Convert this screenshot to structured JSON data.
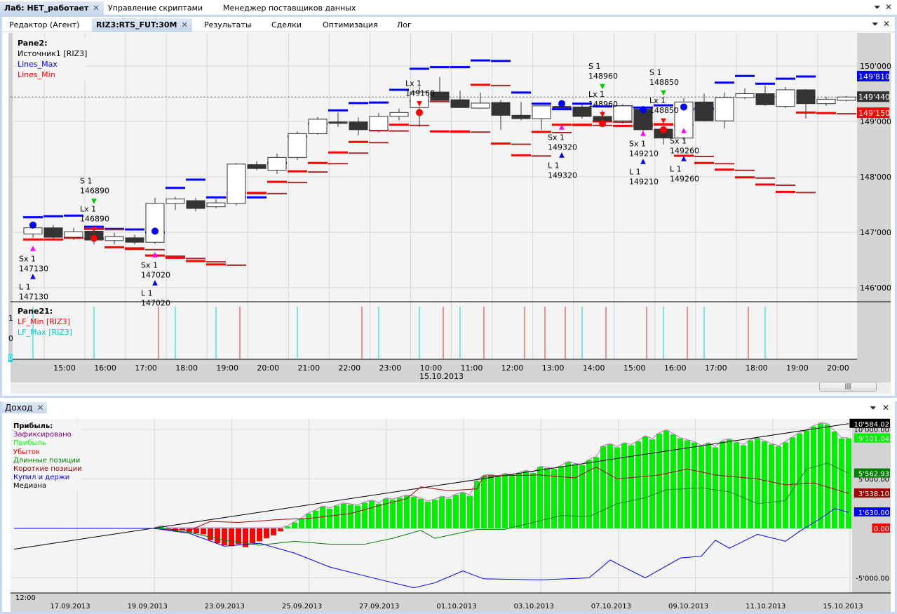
{
  "top_tabs": [
    {
      "label": "Лаб: НЕТ_работает",
      "active": true
    },
    {
      "label": "Управление скриптами"
    },
    {
      "label": "Менеджер поставщиков данных"
    }
  ],
  "sub_tabs": [
    {
      "label": "Редактор (Агент)"
    },
    {
      "label": "RIZ3:RTS_FUT:30M",
      "active": true
    },
    {
      "label": "Результаты"
    },
    {
      "label": "Сделки"
    },
    {
      "label": "Оптимизация"
    },
    {
      "label": "Лог"
    }
  ],
  "colors": {
    "max": "#0000ff",
    "min": "#ff0000",
    "min_dark": "#a52a2a",
    "cyan": "#00d8d8",
    "profit": "#00ee00",
    "loss": "#ff0000"
  },
  "price_pane": {
    "title": "Pane2:",
    "source": "Источник1 [RIZ3]",
    "legend_max": "Lines_Max",
    "legend_min": "Lines_Min",
    "y_ticks": [
      "150'000",
      "149'000",
      "148'000",
      "147'000",
      "146'000"
    ],
    "markers": {
      "max": "149'810",
      "last": "149'440",
      "min": "149'150"
    }
  },
  "indicator_pane": {
    "title": "Pane21:",
    "legend_min": "LF_Min [RIZ3]",
    "legend_max": "LF_Max [RIZ3]",
    "y_ticks": [
      "1",
      "0",
      "0"
    ],
    "min_bars": [
      6,
      10,
      16,
      20,
      22,
      24,
      25,
      26,
      28,
      30,
      32,
      35
    ],
    "max_bars": [
      0,
      3,
      7,
      9,
      13,
      17,
      19,
      21,
      27,
      31,
      33,
      36
    ]
  },
  "time_axis": {
    "labels": [
      "15:00",
      "16:00",
      "17:00",
      "18:00",
      "19:00",
      "20:00",
      "21:00",
      "22:00",
      "23:00",
      "10:00",
      "11:00",
      "12:00",
      "13:00",
      "14:00",
      "15:00",
      "16:00",
      "17:00",
      "18:00",
      "19:00",
      "20:00"
    ],
    "date": "15.10.2013"
  },
  "candles": [
    [
      146970,
      147130,
      146900,
      147080
    ],
    [
      147080,
      147130,
      146880,
      146910
    ],
    [
      146910,
      147080,
      146860,
      147010
    ],
    [
      147020,
      147050,
      146780,
      146860
    ],
    [
      146850,
      146990,
      146780,
      146920
    ],
    [
      146900,
      146960,
      146780,
      146820
    ],
    [
      146820,
      147620,
      146790,
      147520
    ],
    [
      147520,
      147640,
      147400,
      147600
    ],
    [
      147570,
      147620,
      147380,
      147430
    ],
    [
      147460,
      147600,
      147430,
      147530
    ],
    [
      147520,
      148250,
      147480,
      148230
    ],
    [
      148220,
      148280,
      148120,
      148150
    ],
    [
      148120,
      148420,
      148050,
      148350
    ],
    [
      148350,
      148820,
      148300,
      148780
    ],
    [
      148780,
      149080,
      148760,
      149040
    ],
    [
      148990,
      149160,
      148900,
      148980
    ],
    [
      148990,
      149070,
      148750,
      148850
    ],
    [
      148840,
      149150,
      148800,
      149090
    ],
    [
      149090,
      149230,
      149020,
      149160
    ],
    [
      149250,
      149620,
      148900,
      149530
    ],
    [
      149530,
      149800,
      149480,
      149380
    ],
    [
      149390,
      149550,
      149300,
      149250
    ],
    [
      149240,
      149520,
      149230,
      149330
    ],
    [
      149340,
      149380,
      148850,
      149110
    ],
    [
      149110,
      149350,
      149020,
      149050
    ],
    [
      149050,
      149280,
      148850,
      149280
    ],
    [
      149270,
      149310,
      149210,
      149250
    ],
    [
      149260,
      149300,
      149050,
      149090
    ],
    [
      149090,
      149200,
      149000,
      149010
    ],
    [
      149010,
      149310,
      148960,
      149280
    ],
    [
      149220,
      149280,
      148780,
      148850
    ],
    [
      148860,
      148900,
      148580,
      148700
    ],
    [
      148700,
      149420,
      148650,
      149350
    ],
    [
      149350,
      149500,
      149000,
      149010
    ],
    [
      149010,
      149520,
      148870,
      149430
    ],
    [
      149430,
      149600,
      149400,
      149500
    ],
    [
      149500,
      149650,
      149280,
      149300
    ],
    [
      149270,
      149620,
      149240,
      149570
    ],
    [
      149570,
      149580,
      149050,
      149320
    ],
    [
      149320,
      149450,
      149280,
      149400
    ],
    [
      149380,
      149460,
      149360,
      149440
    ]
  ],
  "lines_max": [
    147270,
    147290,
    147300,
    147100,
    147060,
    147050,
    147000,
    147800,
    147950,
    147630,
    147630,
    147630,
    148250,
    148730,
    148960,
    149200,
    149330,
    149340,
    149570,
    149950,
    149980,
    149980,
    150100,
    150090,
    149520,
    149320,
    149220,
    149320,
    149270,
    149270,
    149250,
    149290,
    149220,
    149230,
    149700,
    149820,
    149680,
    149770,
    149810
  ],
  "lines_min": [
    146870,
    146870,
    146900,
    147060,
    146730,
    146700,
    146580,
    146540,
    146480,
    146420,
    147710,
    147710,
    147910,
    148100,
    148250,
    148440,
    148630,
    148840,
    148940,
    149370,
    148820,
    148820,
    149660,
    148600,
    148390,
    148810,
    148940,
    148940,
    149000,
    148920,
    148950,
    148950,
    148380,
    148250,
    148130,
    147990,
    147860,
    147730,
    149160,
    149150
  ],
  "signals": [
    {
      "bar": 0,
      "side": "below",
      "entries": [
        {
          "name": "Sx 1",
          "price": "147130",
          "icon": "short-exit"
        },
        {
          "name": "L 1",
          "price": "147130",
          "icon": "buy"
        }
      ]
    },
    {
      "bar": 3,
      "side": "above",
      "entries": [
        {
          "name": "S 1",
          "price": "146890",
          "icon": "sell"
        },
        {
          "name": "Lx 1",
          "price": "146890",
          "icon": "long-exit"
        }
      ]
    },
    {
      "bar": 6,
      "side": "below",
      "entries": [
        {
          "name": "Sx 1",
          "price": "147020",
          "icon": "short-exit"
        },
        {
          "name": "L 1",
          "price": "147020",
          "icon": "buy"
        }
      ]
    },
    {
      "bar": 19,
      "side": "above",
      "entries": [
        {
          "name": "Lx 1",
          "price": "149160",
          "icon": "long-exit"
        }
      ]
    },
    {
      "bar": 26,
      "side": "below",
      "entries": [
        {
          "name": "Sx 1",
          "price": "149320",
          "icon": "short-exit"
        },
        {
          "name": "L 1",
          "price": "149320",
          "icon": "buy"
        }
      ]
    },
    {
      "bar": 28,
      "side": "above",
      "entries": [
        {
          "name": "S 1",
          "price": "148960",
          "icon": "sell"
        },
        {
          "name": "Lx 1",
          "price": "148960",
          "icon": "long-exit"
        }
      ]
    },
    {
      "bar": 30,
      "side": "below",
      "entries": [
        {
          "name": "Sx 1",
          "price": "149210",
          "icon": "short-exit"
        },
        {
          "name": "L 1",
          "price": "149210",
          "icon": "buy"
        }
      ]
    },
    {
      "bar": 31,
      "side": "above",
      "entries": [
        {
          "name": "S 1",
          "price": "148850",
          "icon": "sell"
        },
        {
          "name": "Lx 1",
          "price": "148850",
          "icon": "long-exit"
        }
      ]
    },
    {
      "bar": 32,
      "side": "below",
      "entries": [
        {
          "name": "Sx 1",
          "price": "149260",
          "icon": "short-exit"
        },
        {
          "name": "L 1",
          "price": "149260",
          "icon": "buy"
        }
      ]
    }
  ],
  "income": {
    "tab": "Доход",
    "legend_title": "Прибыль:",
    "legend": [
      {
        "label": "Зафиксировано",
        "color": "#800080"
      },
      {
        "label": "Прибыль",
        "color": "#00ff00"
      },
      {
        "label": "Убыток",
        "color": "#ff0000"
      },
      {
        "label": "Длинные позиции",
        "color": "#008000"
      },
      {
        "label": "Короткие позиции",
        "color": "#a00000"
      },
      {
        "label": "Купил и держи",
        "color": "#0000ff"
      },
      {
        "label": "Медиана",
        "color": "#000000"
      }
    ],
    "y_ticks": [
      {
        "v": 10000,
        "t": "10'000.00"
      },
      {
        "v": 5000,
        "t": "5'000.00"
      },
      {
        "v": -5000,
        "t": "-5'000.00"
      }
    ],
    "markers": [
      {
        "v": 10584.02,
        "t": "10'584.02",
        "bg": "#000000",
        "fg": "#ffffff"
      },
      {
        "v": 9101.04,
        "t": "9'101.04",
        "bg": "#00ee00",
        "fg": "#ffffff"
      },
      {
        "v": 5562.93,
        "t": "5'562.93",
        "bg": "#008000",
        "fg": "#ffffff"
      },
      {
        "v": 3538.1,
        "t": "3'538.10",
        "bg": "#a00000",
        "fg": "#ffffff"
      },
      {
        "v": 1630.0,
        "t": "1'630.00",
        "bg": "#0000ff",
        "fg": "#ffffff"
      },
      {
        "v": 0,
        "t": "0.00",
        "bg": "#ff0000",
        "fg": "#ffffff"
      }
    ],
    "x_top_label": "12:00",
    "x_labels": [
      "17.09.2013",
      "19.09.2013",
      "23.09.2013",
      "25.09.2013",
      "27.09.2013",
      "01.10.2013",
      "03.10.2013",
      "07.10.2013",
      "09.10.2013",
      "11.10.2013",
      "15.10.2013"
    ],
    "profit": [
      0,
      200,
      -100,
      -300,
      -200,
      -400,
      -500,
      -600,
      -1200,
      -1500,
      -1700,
      -1800,
      -1600,
      -1900,
      -1500,
      -1300,
      -1000,
      -700,
      -300,
      200,
      600,
      1000,
      1500,
      1800,
      2200,
      2000,
      2300,
      2500,
      2400,
      2300,
      2600,
      2800,
      2500,
      3000,
      2900,
      3100,
      3300,
      3200,
      3000,
      2700,
      2900,
      3200,
      3000,
      3400,
      3600,
      3300,
      4800,
      5300,
      5400,
      5200,
      5500,
      5300,
      5600,
      5800,
      5600,
      6200,
      6100,
      6000,
      6300,
      6700,
      6500,
      6400,
      6900,
      7200,
      8300,
      8500,
      8200,
      8600,
      8400,
      8800,
      9300,
      9000,
      9600,
      9900,
      9500,
      9100,
      8900,
      8700,
      8300,
      8600,
      8200,
      8800,
      9000,
      8700,
      8400,
      8900,
      9100,
      8800,
      8500,
      8300,
      8700,
      9200,
      9600,
      9900,
      10300,
      10600,
      10500,
      9800,
      9100,
      9100
    ],
    "series": [
      {
        "name": "Медиана",
        "color": "#000000",
        "points": [
          [
            -20,
            -2100
          ],
          [
            99,
            10584
          ]
        ]
      },
      {
        "name": "Короткие позиции",
        "color": "#a00000",
        "points": [
          [
            0,
            0
          ],
          [
            5,
            -200
          ],
          [
            8,
            700
          ],
          [
            12,
            600
          ],
          [
            18,
            900
          ],
          [
            22,
            1000
          ],
          [
            28,
            1500
          ],
          [
            32,
            2300
          ],
          [
            36,
            3000
          ],
          [
            38,
            4200
          ],
          [
            42,
            3800
          ],
          [
            46,
            4000
          ],
          [
            47,
            5300
          ],
          [
            55,
            5400
          ],
          [
            60,
            5100
          ],
          [
            63,
            6200
          ],
          [
            66,
            5000
          ],
          [
            72,
            5400
          ],
          [
            76,
            6000
          ],
          [
            80,
            5400
          ],
          [
            86,
            5000
          ],
          [
            90,
            4400
          ],
          [
            94,
            4600
          ],
          [
            99,
            3538
          ]
        ]
      },
      {
        "name": "Длинные позиции",
        "color": "#008000",
        "points": [
          [
            0,
            0
          ],
          [
            5,
            -400
          ],
          [
            10,
            -1200
          ],
          [
            15,
            -1700
          ],
          [
            20,
            -1300
          ],
          [
            25,
            -1600
          ],
          [
            30,
            -1600
          ],
          [
            34,
            -1000
          ],
          [
            38,
            -200
          ],
          [
            40,
            -1000
          ],
          [
            46,
            -100
          ],
          [
            50,
            -100
          ],
          [
            58,
            1300
          ],
          [
            62,
            1200
          ],
          [
            66,
            2500
          ],
          [
            70,
            3100
          ],
          [
            73,
            3900
          ],
          [
            78,
            4100
          ],
          [
            82,
            3700
          ],
          [
            86,
            2500
          ],
          [
            90,
            2800
          ],
          [
            93,
            6000
          ],
          [
            96,
            6600
          ],
          [
            99,
            5562
          ]
        ]
      },
      {
        "name": "Купил и держи",
        "color": "#0000ff",
        "points": [
          [
            -20,
            0
          ],
          [
            0,
            0
          ],
          [
            5,
            -500
          ],
          [
            10,
            -1800
          ],
          [
            15,
            -1500
          ],
          [
            20,
            -2500
          ],
          [
            25,
            -3900
          ],
          [
            30,
            -4800
          ],
          [
            37,
            -6000
          ],
          [
            40,
            -5500
          ],
          [
            44,
            -4300
          ],
          [
            47,
            -5100
          ],
          [
            55,
            -5200
          ],
          [
            62,
            -5000
          ],
          [
            65,
            -3200
          ],
          [
            70,
            -5000
          ],
          [
            75,
            -3000
          ],
          [
            78,
            -2800
          ],
          [
            80,
            -1200
          ],
          [
            82,
            -2000
          ],
          [
            86,
            -600
          ],
          [
            90,
            -1300
          ],
          [
            92,
            -300
          ],
          [
            95,
            1000
          ],
          [
            97,
            2000
          ],
          [
            99,
            1630
          ]
        ]
      }
    ]
  }
}
